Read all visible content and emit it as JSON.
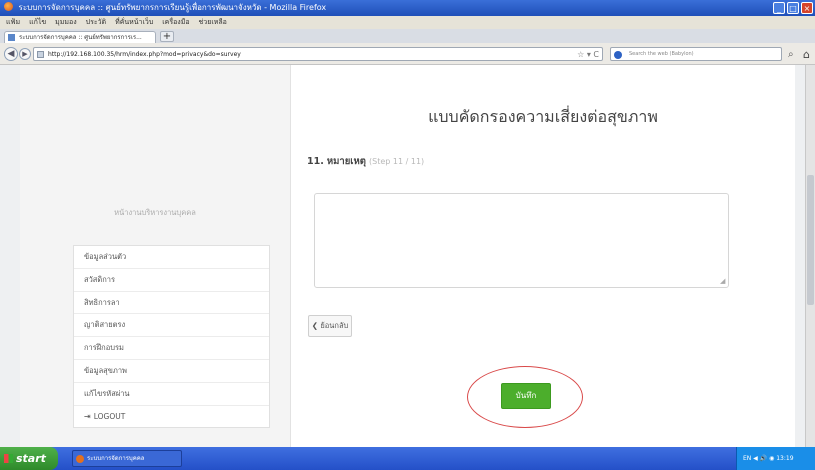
{
  "window": {
    "title": "ระบบการจัดการบุคคล :: ศูนย์ทรัพยากรการเรียนรู้เพื่อการพัฒนาจังหวัด - Mozilla Firefox",
    "controls": {
      "minimize": "_",
      "maximize": "□",
      "close": "×"
    }
  },
  "menubar": [
    "แฟ้ม",
    "แก้ไข",
    "มุมมอง",
    "ประวัติ",
    "ที่คั่นหน้าเว็บ",
    "เครื่องมือ",
    "ช่วยเหลือ"
  ],
  "tabs": [
    {
      "label": "ระบบการจัดการบุคคล :: ศูนย์ทรัพยากรการเร..."
    }
  ],
  "newtab_label": "+",
  "navbar": {
    "url": "http://192.168.100.35/hrm/index.php?mod=privacy&do=survey",
    "search_placeholder": "Search the web (Babylon)"
  },
  "sidebar": {
    "title": "หน้างานบริหารงานบุคคล",
    "items": [
      {
        "label": "ข้อมูลส่วนตัว"
      },
      {
        "label": "สวัสดิการ"
      },
      {
        "label": "สิทธิการลา"
      },
      {
        "label": "ญาติสายตรง"
      },
      {
        "label": "การฝึกอบรม"
      },
      {
        "label": "ข้อมูลสุขภาพ"
      },
      {
        "label": "แก้ไขรหัสผ่าน"
      },
      {
        "label": "LOGOUT"
      }
    ]
  },
  "main": {
    "title": "แบบคัดกรองความเสี่ยงต่อสุขภาพ",
    "step": {
      "number": "11.",
      "name": "หมายเหตุ",
      "progress": "(Step 11 / 11)"
    },
    "notes_value": "",
    "back_label": "❮ ย้อนกลับ",
    "save_label": "บันทึก"
  },
  "taskbar": {
    "start_label": "start",
    "item_label": "ระบบการจัดการบุคคล",
    "tray": "EN ◀ 🔊 ◉ 13:19"
  }
}
